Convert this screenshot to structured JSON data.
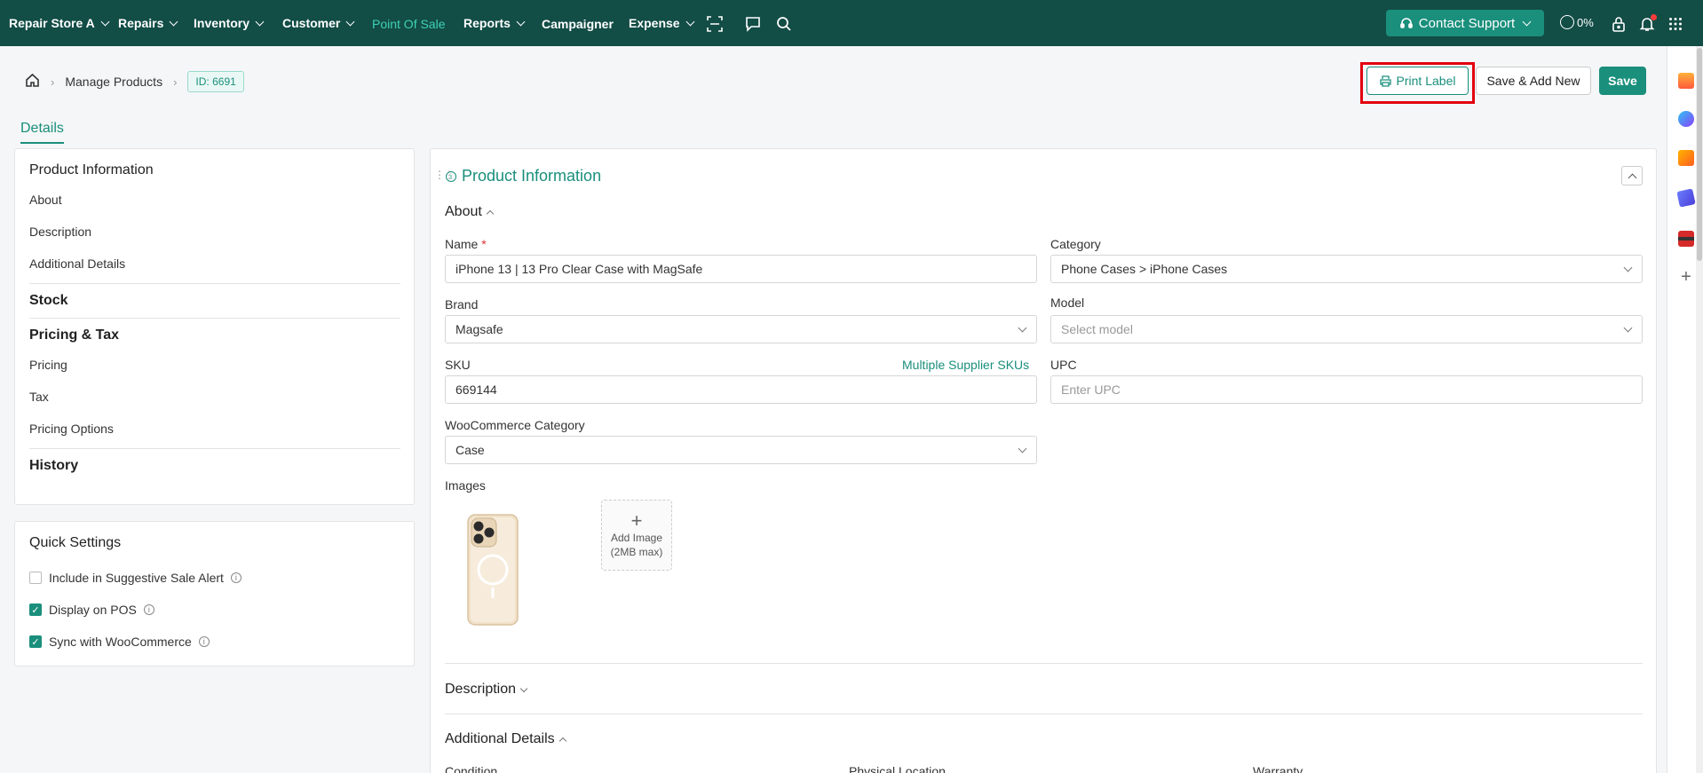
{
  "nav": {
    "items": [
      {
        "label": "Repair Store A",
        "dropdown": true
      },
      {
        "label": "Repairs",
        "dropdown": true
      },
      {
        "label": "Inventory",
        "dropdown": true
      },
      {
        "label": "Customer",
        "dropdown": true
      },
      {
        "label": "Point Of Sale",
        "dropdown": false,
        "active": true
      },
      {
        "label": "Reports",
        "dropdown": true
      },
      {
        "label": "Campaigner",
        "dropdown": false
      },
      {
        "label": "Expense",
        "dropdown": true
      }
    ],
    "contact_support": "Contact Support",
    "progress": "0%"
  },
  "breadcrumb": {
    "section": "Manage Products",
    "id_badge": "ID: 6691"
  },
  "actions": {
    "print_label": "Print Label",
    "save_add_new": "Save & Add New",
    "save": "Save"
  },
  "tabs": {
    "details": "Details"
  },
  "side_nav": {
    "product_information": "Product Information",
    "about": "About",
    "description": "Description",
    "additional_details": "Additional Details",
    "stock": "Stock",
    "pricing_tax": "Pricing & Tax",
    "pricing": "Pricing",
    "tax": "Tax",
    "pricing_options": "Pricing Options",
    "history": "History"
  },
  "quick_settings": {
    "title": "Quick Settings",
    "items": [
      {
        "label": "Include in Suggestive Sale Alert",
        "checked": false
      },
      {
        "label": "Display on POS",
        "checked": true
      },
      {
        "label": "Sync with WooCommerce",
        "checked": true
      }
    ]
  },
  "main": {
    "title": "Product Information",
    "about_title": "About",
    "name_label": "Name",
    "name_value": "iPhone 13 | 13 Pro Clear Case with MagSafe",
    "category_label": "Category",
    "category_value": "Phone Cases > iPhone Cases",
    "brand_label": "Brand",
    "brand_value": "Magsafe",
    "model_label": "Model",
    "model_placeholder": "Select model",
    "sku_label": "SKU",
    "multiple_supplier_skus": "Multiple Supplier SKUs",
    "sku_value": "669144",
    "upc_label": "UPC",
    "upc_placeholder": "Enter UPC",
    "woo_category_label": "WooCommerce Category",
    "woo_category_value": "Case",
    "images_label": "Images",
    "add_image": "Add Image",
    "add_image_hint": "(2MB max)",
    "description_title": "Description",
    "additional_details_title": "Additional Details",
    "condition_label": "Condition",
    "physical_location_label": "Physical Location",
    "warranty_label": "Warranty"
  },
  "colors": {
    "nav_bg": "#124d46",
    "accent": "#1a8f7c",
    "active_nav": "#3fd1b4",
    "highlight": "#e3000f"
  }
}
